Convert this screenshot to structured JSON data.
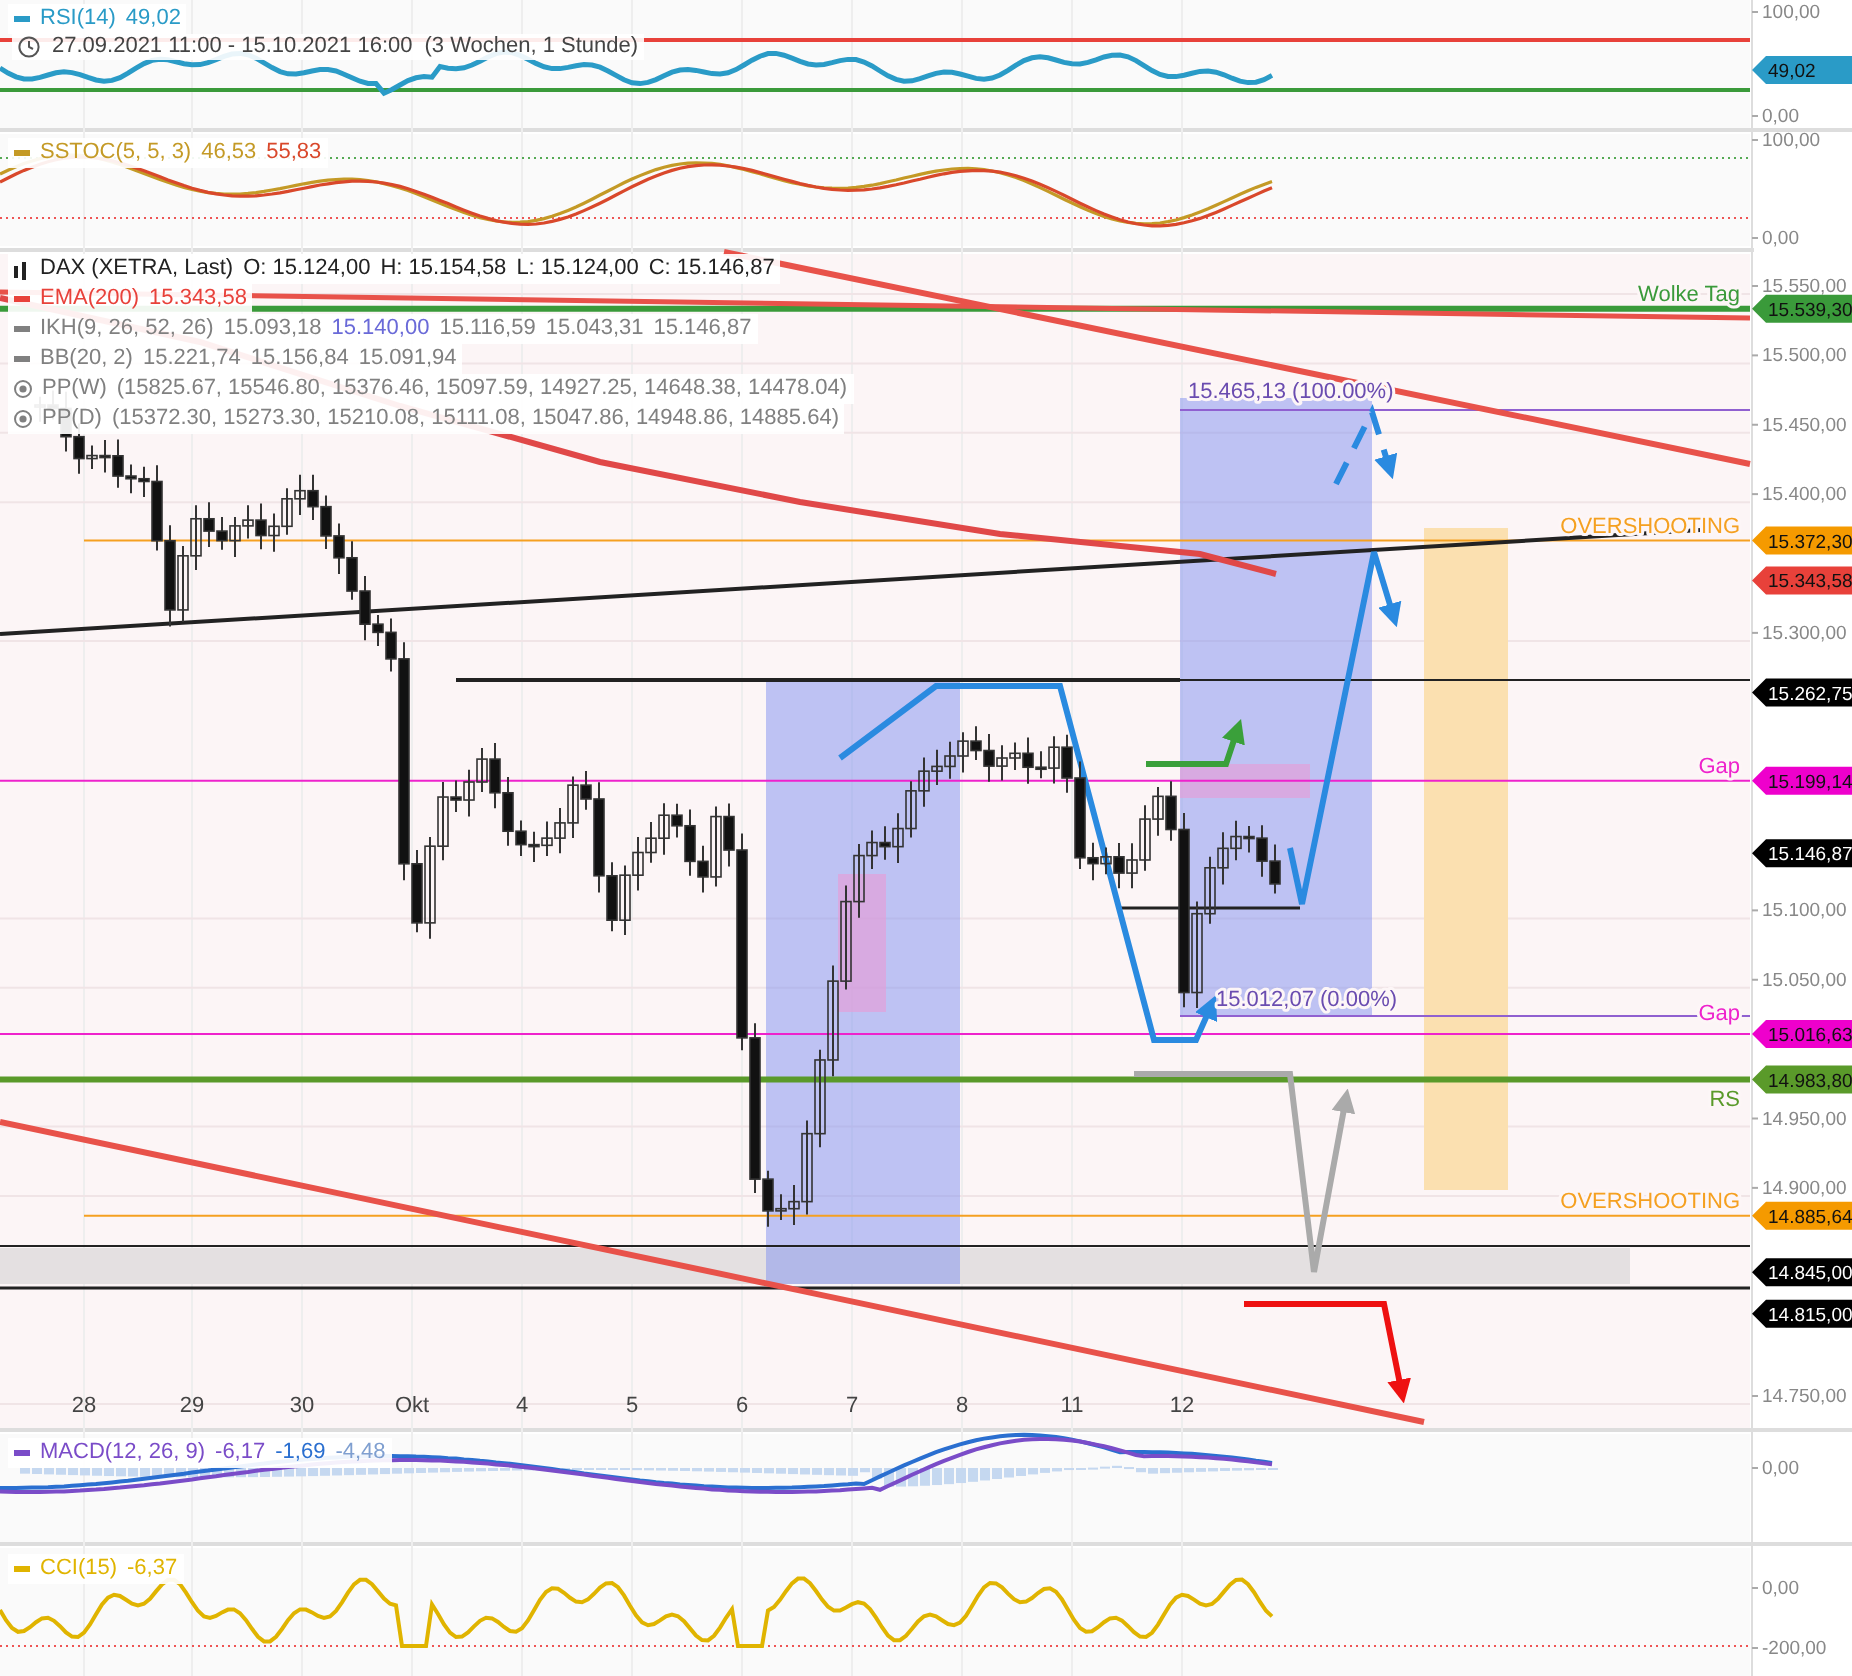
{
  "rsi_panel": {
    "legend": {
      "name": "RSI(14)",
      "color": "#2a9bc7",
      "values": [
        {
          "text": "49,02",
          "color": "#2a9bc7"
        }
      ]
    },
    "date_range": "27.09.2021 11:00 - 15.10.2021 16:00",
    "period": "(3 Wochen, 1 Stunde)",
    "axis_labels": [
      "100,00",
      "0,00"
    ],
    "price_tag": {
      "text": "49,02",
      "color": "#2a9bc7"
    }
  },
  "sstoc_panel": {
    "legend": {
      "name": "SSTOC(5, 5, 3)",
      "color": "#c49a26",
      "values": [
        {
          "text": "46,53",
          "color": "#c49a26"
        },
        {
          "text": "55,83",
          "color": "#d9482b"
        }
      ]
    },
    "axis_labels": [
      "100,00",
      "0,00"
    ]
  },
  "main_panel": {
    "legend": [
      {
        "name": "DAX (XETRA, Last)",
        "kind": "candles",
        "color": "#222222",
        "values": [
          {
            "text": "O: 15.124,00",
            "color": "#222222"
          },
          {
            "text": "H: 15.154,58",
            "color": "#222222"
          },
          {
            "text": "L: 15.124,00",
            "color": "#222222"
          },
          {
            "text": "C: 15.146,87",
            "color": "#222222"
          }
        ]
      },
      {
        "name": "EMA(200)",
        "kind": "line",
        "color": "#e8413a",
        "values": [
          {
            "text": "15.343,58",
            "color": "#e8413a"
          }
        ]
      },
      {
        "name": "IKH(9, 26, 52, 26)",
        "kind": "line",
        "color": "#808080",
        "values": [
          {
            "text": "15.093,18",
            "color": "#808080"
          },
          {
            "text": "15.140,00",
            "color": "#6a6ad8"
          },
          {
            "text": "15.116,59",
            "color": "#808080"
          },
          {
            "text": "15.043,31",
            "color": "#808080"
          },
          {
            "text": "15.146,87",
            "color": "#808080"
          }
        ]
      },
      {
        "name": "BB(20, 2)",
        "kind": "line",
        "color": "#808080",
        "values": [
          {
            "text": "15.221,74",
            "color": "#808080"
          },
          {
            "text": "15.156,84",
            "color": "#808080"
          },
          {
            "text": "15.091,94",
            "color": "#808080"
          }
        ]
      },
      {
        "name": "PP(W)",
        "kind": "pivot",
        "color": "#808080",
        "values": [
          {
            "text": "(15825.67, 15546.80, 15376.46, 15097.59, 14927.25, 14648.38, 14478.04)",
            "color": "#808080"
          }
        ]
      },
      {
        "name": "PP(D)",
        "kind": "pivot",
        "color": "#808080",
        "values": [
          {
            "text": "(15372.30, 15273.30, 15210.08, 15111.08, 15047.86, 14948.86, 14885.64)",
            "color": "#808080"
          }
        ]
      }
    ],
    "axis_labels": [
      "15.550,00",
      "15.500,00",
      "15.450,00",
      "15.400,00",
      "15.300,00",
      "15.100,00",
      "15.050,00",
      "14.950,00",
      "14.900,00",
      "14.750,00"
    ],
    "levels": [
      {
        "label": "Wolke Tag",
        "color": "#3a9a3a"
      },
      {
        "label": "OVERSHOOTING",
        "color": "#f5a020"
      },
      {
        "label": "Gap",
        "color": "#ee22cc"
      },
      {
        "label": "Gap",
        "color": "#ee22cc"
      },
      {
        "label": "RS",
        "color": "#5a9a2a"
      },
      {
        "label": "OVERSHOOTING",
        "color": "#f5a020"
      }
    ],
    "price_tags": [
      {
        "text": "15.539,30",
        "color": "#3a9a3a"
      },
      {
        "text": "15.372,30",
        "color": "#f59a00"
      },
      {
        "text": "15.343,58",
        "color": "#e8413a"
      },
      {
        "text": "15.262,75",
        "color": "#000000"
      },
      {
        "text": "15.199,14",
        "color": "#ee00cc"
      },
      {
        "text": "15.146,87",
        "color": "#000000"
      },
      {
        "text": "15.016,63",
        "color": "#ee00cc"
      },
      {
        "text": "14.983,80",
        "color": "#5a9a2a"
      },
      {
        "text": "14.885,64",
        "color": "#f59a00"
      },
      {
        "text": "14.845,00",
        "color": "#000000"
      },
      {
        "text": "14.815,00",
        "color": "#000000"
      }
    ],
    "fib_labels": [
      "15.465,13 (100.00%)",
      "15.012,07 (0.00%)"
    ],
    "x_labels": [
      "28",
      "29",
      "30",
      "Okt",
      "4",
      "5",
      "6",
      "7",
      "8",
      "11",
      "12"
    ]
  },
  "macd_panel": {
    "legend": {
      "name": "MACD(12, 26, 9)",
      "color": "#7a4cc8",
      "values": [
        {
          "text": "-6,17",
          "color": "#7a4cc8"
        },
        {
          "text": "-1,69",
          "color": "#2a6fd0"
        },
        {
          "text": "-4,48",
          "color": "#7f9fd0"
        }
      ]
    },
    "axis_labels": [
      "0,00"
    ]
  },
  "cci_panel": {
    "legend": {
      "name": "CCI(15)",
      "color": "#e0b400",
      "values": [
        {
          "text": "-6,37",
          "color": "#e0b400"
        }
      ]
    },
    "axis_labels": [
      "0,00",
      "-200,00"
    ]
  }
}
